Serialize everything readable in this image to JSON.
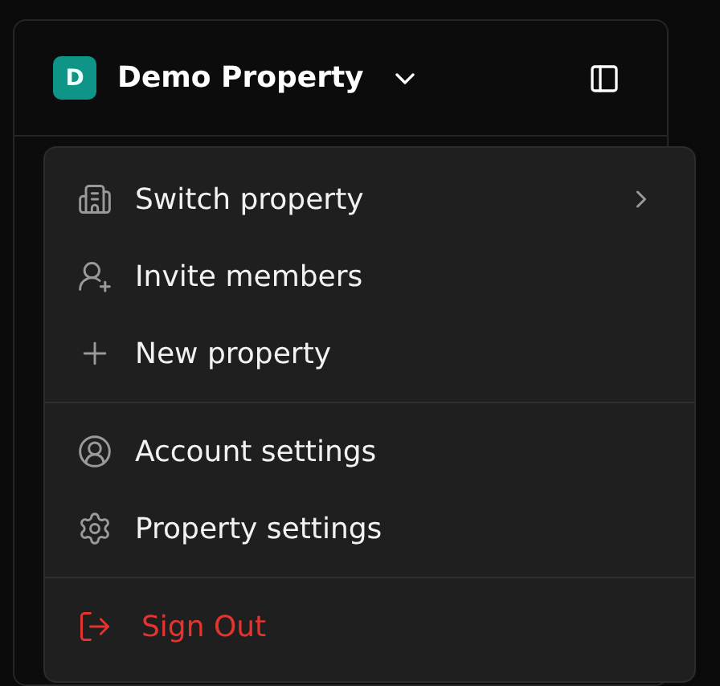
{
  "header": {
    "badge": "D",
    "title": "Demo Property",
    "expanded": true
  },
  "menu": {
    "groups": [
      {
        "items": [
          {
            "label": "Switch property",
            "kind": "submenu"
          },
          {
            "label": "Invite members",
            "kind": "action"
          },
          {
            "label": "New property",
            "kind": "action"
          }
        ]
      },
      {
        "items": [
          {
            "label": "Account settings",
            "kind": "action"
          },
          {
            "label": "Property settings",
            "kind": "action"
          }
        ]
      },
      {
        "items": [
          {
            "label": "Sign Out",
            "kind": "danger"
          }
        ]
      }
    ]
  }
}
